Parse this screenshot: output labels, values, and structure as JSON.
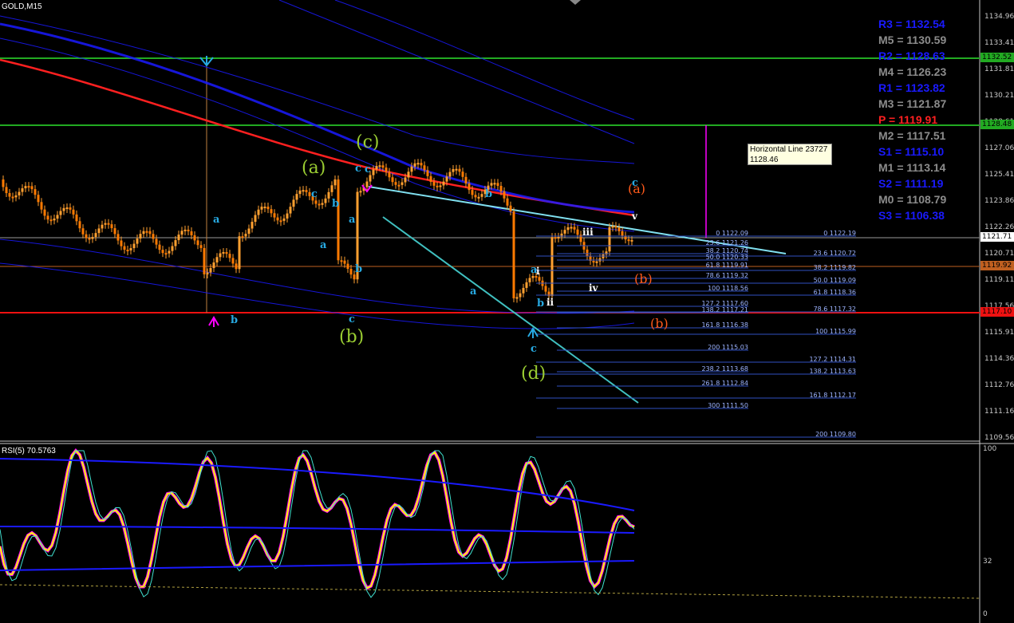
{
  "header": {
    "symbol": "GOLD,M15",
    "rsi_title": "RSI(5) 70.5763"
  },
  "tooltip": {
    "title": "Horizontal Line 23727",
    "value": "1128.46"
  },
  "pivots": [
    {
      "label": "R3 = 1132.54",
      "color": "#1a1aff"
    },
    {
      "label": "M5 = 1130.59",
      "color": "#8c8c8c"
    },
    {
      "label": "R2 = 1128.63",
      "color": "#1a1aff"
    },
    {
      "label": "M4 = 1126.23",
      "color": "#8c8c8c"
    },
    {
      "label": "R1 = 1123.82",
      "color": "#1a1aff"
    },
    {
      "label": "M3 = 1121.87",
      "color": "#8c8c8c"
    },
    {
      "label": "P   = 1119.91",
      "color": "#ff2020"
    },
    {
      "label": "M2 = 1117.51",
      "color": "#8c8c8c"
    },
    {
      "label": "S1 = 1115.10",
      "color": "#1a1aff"
    },
    {
      "label": "M1 = 1113.14",
      "color": "#8c8c8c"
    },
    {
      "label": "S2 = 1111.19",
      "color": "#1a1aff"
    },
    {
      "label": "M0 = 1108.79",
      "color": "#8c8c8c"
    },
    {
      "label": "S3 = 1106.38",
      "color": "#1a1aff"
    }
  ],
  "price_axis": [
    "1134.96",
    "1133.41",
    "1131.81",
    "1130.21",
    "1128.61",
    "1127.06",
    "1125.41",
    "1123.86",
    "1122.26",
    "1120.71",
    "1119.11",
    "1117.56",
    "1115.91",
    "1114.36",
    "1112.76",
    "1111.16",
    "1109.56"
  ],
  "price_tags": [
    {
      "label": "1132.52",
      "bg": "#22aa22",
      "fg": "#000000"
    },
    {
      "label": "1128.48",
      "bg": "#22aa22",
      "fg": "#000000"
    },
    {
      "label": "1121.71",
      "bg": "#ffffff",
      "fg": "#000000"
    },
    {
      "label": "1119.92",
      "bg": "#c06020",
      "fg": "#000000"
    },
    {
      "label": "1117.10",
      "bg": "#ee1111",
      "fg": "#000000"
    }
  ],
  "rsi_axis": [
    "100",
    "32",
    "0"
  ],
  "fib_left": [
    "0 1122.09",
    "23.6 1121.26",
    "38.2 1120.74",
    "50.0 1120.33",
    "61.8 1119.91",
    "78.6 1119.32",
    "100 1118.56",
    "127.2 1117.60",
    "138.2 1117.21",
    "161.8 1116.38",
    "200 1115.03",
    "238.2 1113.68",
    "261.8 1112.84",
    "300 1111.50"
  ],
  "fib_right": [
    "0 1122.19",
    "23.6 1120.72",
    "38.2 1119.82",
    "50.0 1119.09",
    "61.8 1118.36",
    "78.6 1117.32",
    "100 1115.99",
    "127.2 1114.31",
    "138.2 1113.63",
    "161.8 1112.17",
    "200 1109.80"
  ],
  "wave_labels": [
    {
      "t": "(a)",
      "c": "#9acd32"
    },
    {
      "t": "(b)",
      "c": "#9acd32"
    },
    {
      "t": "(c)",
      "c": "#9acd32"
    },
    {
      "t": "(d)",
      "c": "#9acd32"
    },
    {
      "t": "(a)",
      "c": "#ff5a1a"
    },
    {
      "t": "(b)",
      "c": "#ff5a1a"
    },
    {
      "t": "(b)",
      "c": "#ff5a1a"
    },
    {
      "t": "a",
      "c": "#27a9e1"
    },
    {
      "t": "b",
      "c": "#27a9e1"
    },
    {
      "t": "c",
      "c": "#27a9e1"
    },
    {
      "t": "a",
      "c": "#27a9e1"
    },
    {
      "t": "b",
      "c": "#27a9e1"
    },
    {
      "t": "c",
      "c": "#27a9e1"
    },
    {
      "t": "a",
      "c": "#27a9e1"
    },
    {
      "t": "b",
      "c": "#27a9e1"
    },
    {
      "t": "c",
      "c": "#27a9e1"
    },
    {
      "t": "a",
      "c": "#27a9e1"
    },
    {
      "t": "b",
      "c": "#27a9e1"
    },
    {
      "t": "c",
      "c": "#27a9e1"
    },
    {
      "t": "a",
      "c": "#27a9e1"
    },
    {
      "t": "b",
      "c": "#27a9e1"
    },
    {
      "t": "c",
      "c": "#27a9e1"
    },
    {
      "t": "c",
      "c": "#27a9e1"
    },
    {
      "t": "i",
      "c": "#ffffff"
    },
    {
      "t": "ii",
      "c": "#ffffff"
    },
    {
      "t": "iii",
      "c": "#ffffff"
    },
    {
      "t": "iv",
      "c": "#ffffff"
    },
    {
      "t": "v",
      "c": "#ffffff"
    }
  ],
  "colors": {
    "ma_red": "#ff2020",
    "ma_blue": "#1a1aff",
    "trend_cyan": "#40c0c0",
    "trend_light": "#80e0f0",
    "green_line": "#22aa22",
    "magenta": "#ff00ff",
    "rsi_yellow": "#ffff00"
  }
}
